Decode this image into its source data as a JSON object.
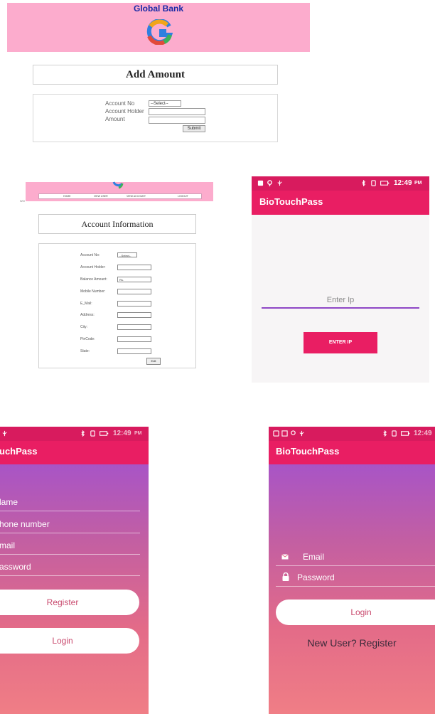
{
  "bank": {
    "title": "Global Bank"
  },
  "add_amount": {
    "title": "Add Amount",
    "account_no_label": "Account No",
    "account_no_select": "--Select--",
    "account_holder_label": "Account Holder",
    "amount_label": "Amount",
    "submit_label": "Submit"
  },
  "account_info": {
    "nav": [
      "HOME",
      "VIEW USER",
      "VIEW ACCOUNT",
      "LOGOUT"
    ],
    "side_text": "WO",
    "title": "Account Information",
    "select_default": "--Select--",
    "edit_label": "Edit",
    "fields": [
      {
        "label": "Account No:",
        "value": ""
      },
      {
        "label": "Account Holder:",
        "value": ""
      },
      {
        "label": "Balance Amount:",
        "value": "Rs."
      },
      {
        "label": "Mobile Number:",
        "value": ""
      },
      {
        "label": "E_Mail:",
        "value": ""
      },
      {
        "label": "Address:",
        "value": ""
      },
      {
        "label": "City:",
        "value": ""
      },
      {
        "label": "PinCode:",
        "value": ""
      },
      {
        "label": "State:",
        "value": ""
      }
    ]
  },
  "phone_ip": {
    "time": "12:49",
    "time_suffix": "PM",
    "app_title": "BioTouchPass",
    "ip_placeholder": "Enter Ip",
    "button_label": "ENTER IP"
  },
  "phone_register": {
    "time": "12:49",
    "time_suffix": "PM",
    "app_title": "uchPass",
    "name_placeholder": "lame",
    "phone_placeholder": "hone number",
    "email_placeholder": "mail",
    "password_placeholder": "assword",
    "register_label": "Register",
    "login_label": "Login"
  },
  "phone_login": {
    "time": "12:49",
    "app_title": "BioTouchPass",
    "email_placeholder": "Email",
    "password_placeholder": "Password",
    "login_label": "Login",
    "register_link": "New User? Register"
  },
  "colors": {
    "bank_header": "#fcaccd",
    "app_bar": "#e91e63",
    "gradient_top": "#9b4fd8",
    "gradient_bottom": "#f07e86"
  }
}
